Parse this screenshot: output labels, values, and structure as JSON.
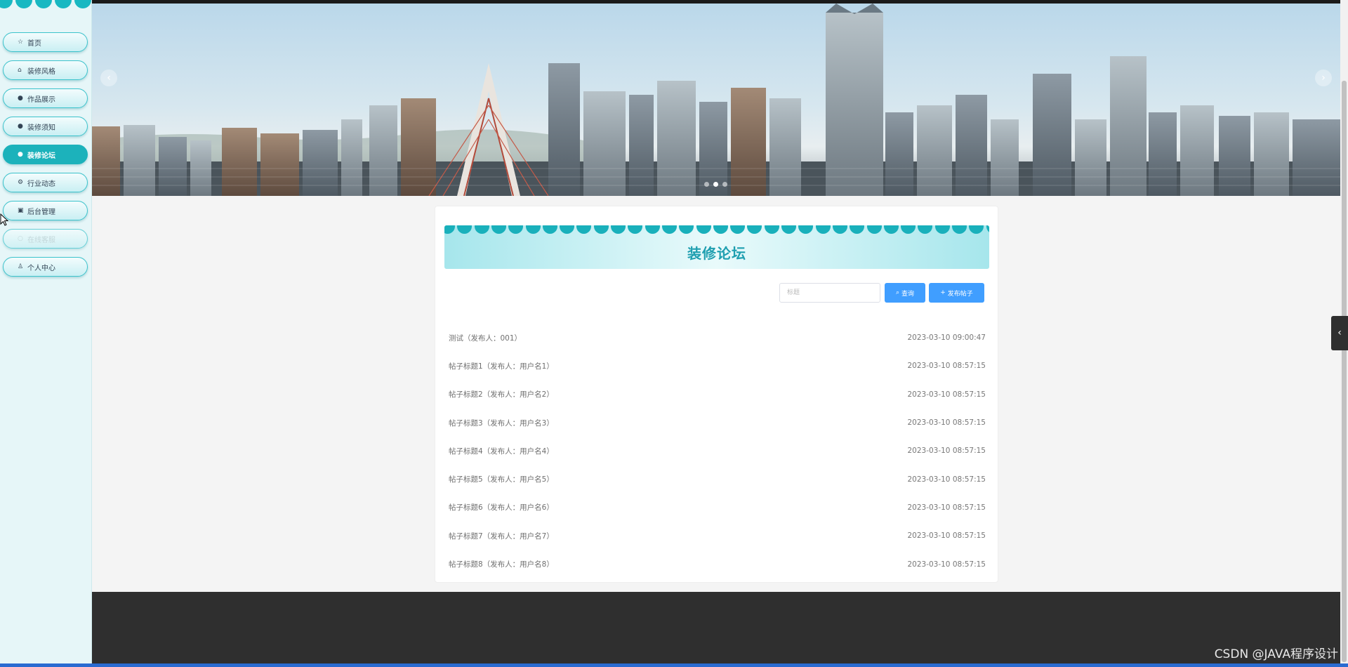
{
  "sidebar": {
    "items": [
      {
        "label": "首页",
        "icon": "star-icon",
        "glyph": "☆",
        "state": "normal"
      },
      {
        "label": "装修风格",
        "icon": "bag-icon",
        "glyph": "⌂",
        "state": "normal"
      },
      {
        "label": "作品展示",
        "icon": "info-icon",
        "glyph": "●",
        "state": "normal"
      },
      {
        "label": "装修须知",
        "icon": "question-icon",
        "glyph": "●",
        "state": "normal"
      },
      {
        "label": "装修论坛",
        "icon": "forum-icon",
        "glyph": "●",
        "state": "active"
      },
      {
        "label": "行业动态",
        "icon": "gear-icon",
        "glyph": "⚙",
        "state": "normal"
      },
      {
        "label": "后台管理",
        "icon": "building-icon",
        "glyph": "▣",
        "state": "normal"
      },
      {
        "label": "在线客服",
        "icon": "chat-icon",
        "glyph": "○",
        "state": "disabled"
      },
      {
        "label": "个人中心",
        "icon": "user-icon",
        "glyph": "♙",
        "state": "normal"
      }
    ]
  },
  "banner": {
    "prev_glyph": "‹",
    "next_glyph": "›",
    "slide_count": 3,
    "active_slide": 2
  },
  "forum": {
    "title": "装修论坛",
    "search_placeholder": "标题",
    "query_label": "查询",
    "post_label": "发布帖子",
    "posts": [
      {
        "title": "测试（发布人：001）",
        "time": "2023-03-10 09:00:47"
      },
      {
        "title": "帖子标题1（发布人：用户名1）",
        "time": "2023-03-10 08:57:15"
      },
      {
        "title": "帖子标题2（发布人：用户名2）",
        "time": "2023-03-10 08:57:15"
      },
      {
        "title": "帖子标题3（发布人：用户名3）",
        "time": "2023-03-10 08:57:15"
      },
      {
        "title": "帖子标题4（发布人：用户名4）",
        "time": "2023-03-10 08:57:15"
      },
      {
        "title": "帖子标题5（发布人：用户名5）",
        "time": "2023-03-10 08:57:15"
      },
      {
        "title": "帖子标题6（发布人：用户名6）",
        "time": "2023-03-10 08:57:15"
      },
      {
        "title": "帖子标题7（发布人：用户名7）",
        "time": "2023-03-10 08:57:15"
      },
      {
        "title": "帖子标题8（发布人：用户名8）",
        "time": "2023-03-10 08:57:15"
      }
    ]
  },
  "watermark": "CSDN @JAVA程序设计",
  "colors": {
    "accent": "#1cb2bb",
    "button": "#409eff",
    "title": "#1f9fb0",
    "footer": "#2f2f2f"
  }
}
